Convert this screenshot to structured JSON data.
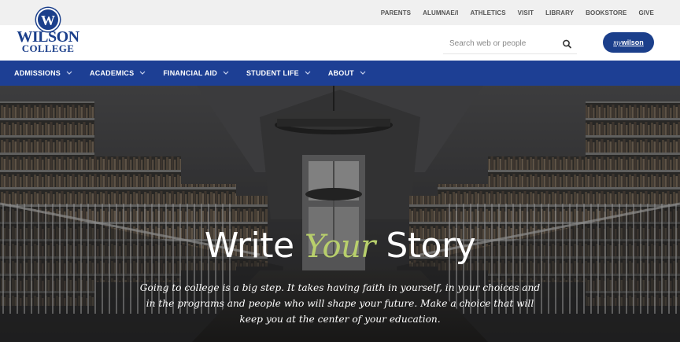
{
  "utility_nav": [
    "PARENTS",
    "ALUMNAE/I",
    "ATHLETICS",
    "VISIT",
    "LIBRARY",
    "BOOKSTORE",
    "GIVE"
  ],
  "logo": {
    "seal_letter": "W",
    "line1": "WILSON",
    "line2": "COLLEGE"
  },
  "search": {
    "placeholder": "Search web or people",
    "icon": "search-icon"
  },
  "portal_button": {
    "prefix": "my",
    "label": "wilson"
  },
  "main_nav": [
    {
      "label": "ADMISSIONS",
      "icon": "chevron-down-icon"
    },
    {
      "label": "ACADEMICS",
      "icon": "chevron-down-icon"
    },
    {
      "label": "FINANCIAL AID",
      "icon": "chevron-down-icon"
    },
    {
      "label": "STUDENT LIFE",
      "icon": "chevron-down-icon"
    },
    {
      "label": "ABOUT",
      "icon": "chevron-down-icon"
    }
  ],
  "hero": {
    "title_before": "Write ",
    "title_accent": "Your",
    "title_after": " Story",
    "copy": "Going to college is a big step. It takes having faith in yourself, in your choices and in the programs and people who will shape your future. Make a choice that will keep you at the center of your education."
  },
  "colors": {
    "brand_blue": "#1d3f94",
    "accent_green": "#b8cf6c",
    "utility_bg": "#f0f0f0"
  }
}
